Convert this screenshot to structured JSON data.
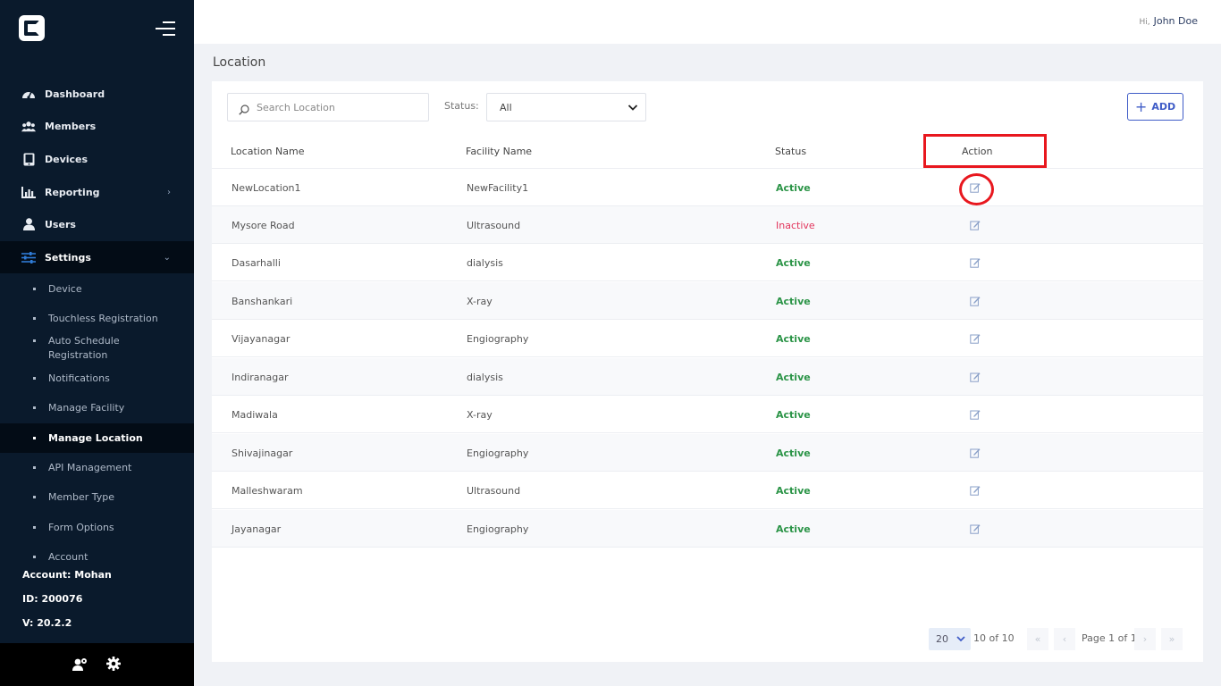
{
  "header": {
    "greeting": "Hi,",
    "user_name": "John Doe"
  },
  "sidebar": {
    "items": [
      {
        "label": "Dashboard",
        "icon": "speedometer-icon"
      },
      {
        "label": "Members",
        "icon": "users-icon"
      },
      {
        "label": "Devices",
        "icon": "tablet-icon"
      },
      {
        "label": "Reporting",
        "icon": "bar-chart-icon",
        "arrow": "›"
      },
      {
        "label": "Users",
        "icon": "user-icon"
      },
      {
        "label": "Settings",
        "icon": "sliders-icon",
        "arrow": "⌄"
      }
    ],
    "sub_items": [
      "Device",
      "Touchless Registration",
      "Auto Schedule Registration",
      "Notifications",
      "Manage Facility",
      "Manage Location",
      "API Management",
      "Member Type",
      "Form Options",
      "Account"
    ],
    "account_line": "Account: Mohan",
    "id_line": "ID: 200076",
    "version_line": "V: 20.2.2"
  },
  "page": {
    "title": "Location"
  },
  "toolbar": {
    "search_placeholder": "Search Location",
    "status_label": "Status:",
    "status_value": "All",
    "add_label": "ADD"
  },
  "table": {
    "headers": [
      "Location Name",
      "Facility Name",
      "Status",
      "Action"
    ],
    "rows": [
      {
        "location": "NewLocation1",
        "facility": "NewFacility1",
        "status": "Active"
      },
      {
        "location": "Mysore Road",
        "facility": "Ultrasound",
        "status": "Inactive"
      },
      {
        "location": "Dasarhalli",
        "facility": "dialysis",
        "status": "Active"
      },
      {
        "location": "Banshankari",
        "facility": "X-ray",
        "status": "Active"
      },
      {
        "location": "Vijayanagar",
        "facility": "Engiography",
        "status": "Active"
      },
      {
        "location": "Indiranagar",
        "facility": "dialysis",
        "status": "Active"
      },
      {
        "location": "Madiwala",
        "facility": "X-ray",
        "status": "Active"
      },
      {
        "location": "Shivajinagar",
        "facility": "Engiography",
        "status": "Active"
      },
      {
        "location": "Malleshwaram",
        "facility": "Ultrasound",
        "status": "Active"
      },
      {
        "location": "Jayanagar",
        "facility": "Engiography",
        "status": "Active"
      }
    ]
  },
  "pagination": {
    "page_size": "20",
    "count_text": "10 of 10",
    "page_text": "Page 1 of 1",
    "first": "«",
    "prev": "‹",
    "next": "›",
    "last": "»"
  },
  "colors": {
    "sidebar_bg": "#0a1a2c",
    "accent": "#3f5cc7",
    "active_status": "#2b9447",
    "inactive_status": "#e2345b",
    "highlight": "#e8171e"
  }
}
